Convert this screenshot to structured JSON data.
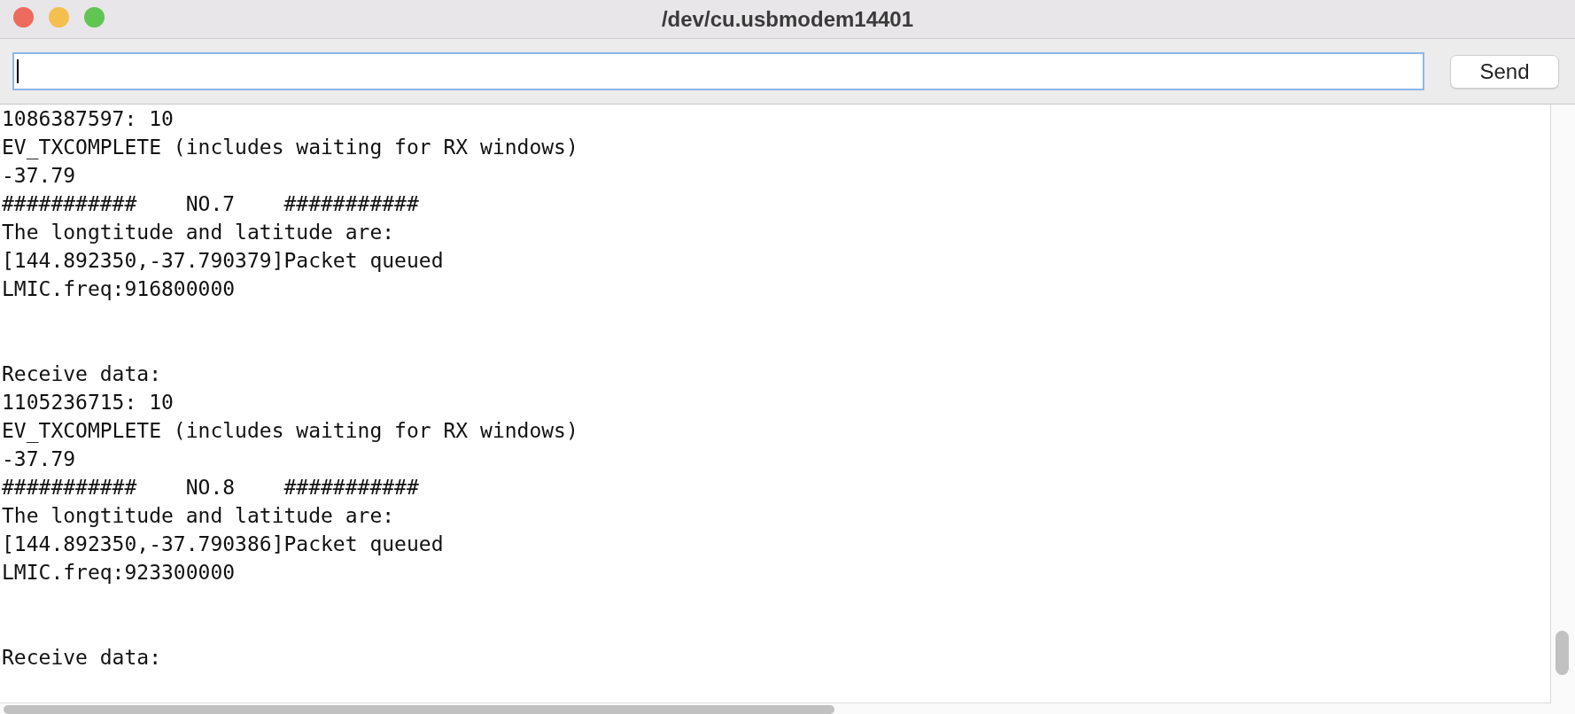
{
  "window": {
    "title": "/dev/cu.usbmodem14401"
  },
  "send_button": {
    "label": "Send"
  },
  "log": {
    "segments": [
      {
        "lines": [
          "1086387597: 10",
          "EV_TXCOMPLETE (includes waiting for RX windows)",
          "-37.79",
          "###########    NO.7    ###########",
          "The longtitude and latitude are:",
          "[144.892350,-37.790379]Packet queued",
          "LMIC.freq:916800000"
        ]
      },
      {
        "lines": [
          "Receive data:",
          "1105236715: 10",
          "EV_TXCOMPLETE (includes waiting for RX windows)",
          "-37.79",
          "###########    NO.8    ###########",
          "The longtitude and latitude are:",
          "[144.892350,-37.790386]Packet queued",
          "LMIC.freq:923300000"
        ]
      },
      {
        "lines": [
          "Receive data:"
        ]
      }
    ]
  }
}
